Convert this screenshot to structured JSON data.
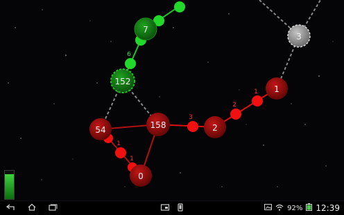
{
  "colors": {
    "player": "#e01010",
    "enemy": "#22c12a",
    "neutral": "#9a9a9a",
    "background": "#050508"
  },
  "nodes": [
    {
      "id": "node-7",
      "label": "7",
      "owner": "enemy"
    },
    {
      "id": "node-152",
      "label": "152",
      "owner": "enemy"
    },
    {
      "id": "node-3",
      "label": "3",
      "owner": "neutral"
    },
    {
      "id": "node-1",
      "label": "1",
      "owner": "player"
    },
    {
      "id": "node-2",
      "label": "2",
      "owner": "player"
    },
    {
      "id": "node-158",
      "label": "158",
      "owner": "player"
    },
    {
      "id": "node-54",
      "label": "54",
      "owner": "player"
    },
    {
      "id": "node-0",
      "label": "0",
      "owner": "player"
    }
  ],
  "units": [
    {
      "label": "6",
      "owner": "enemy"
    },
    {
      "label": "1",
      "owner": "player"
    },
    {
      "label": "2",
      "owner": "player"
    },
    {
      "label": "3",
      "owner": "player"
    },
    {
      "label": "1",
      "owner": "player"
    },
    {
      "label": "1",
      "owner": "player"
    }
  ],
  "power_level": 0.88,
  "navbar": {
    "back_icon": "back-icon",
    "home_icon": "home-icon",
    "recent_icon": "recent-apps-icon",
    "screenshot_icon": "screenshot-icon",
    "phone_icon": "phone-icon"
  },
  "status": {
    "battery": "92%",
    "time": "12:39",
    "wifi_icon": "wifi-icon",
    "image_icon": "gallery-icon"
  }
}
